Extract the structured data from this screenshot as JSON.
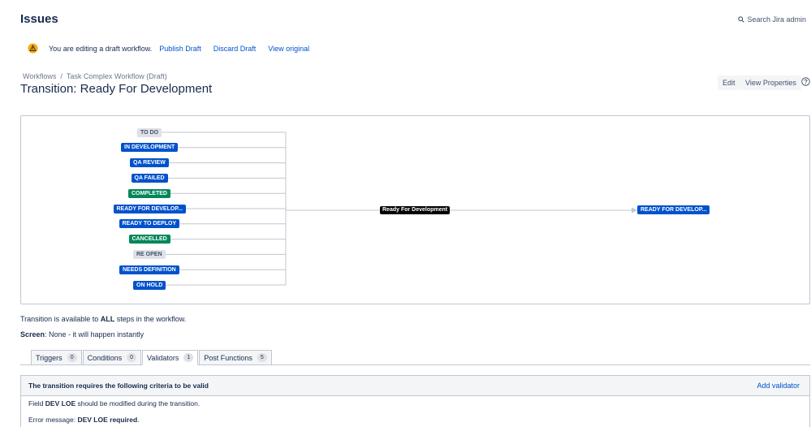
{
  "header": {
    "title": "Issues",
    "search_label": "Search Jira admin"
  },
  "draft_bar": {
    "message": "You are editing a draft workflow.",
    "publish": "Publish Draft",
    "discard": "Discard Draft",
    "view_original": "View original"
  },
  "breadcrumb": {
    "root": "Workflows",
    "sep": "/",
    "workflow": "Task Complex Workflow (Draft)"
  },
  "page": {
    "heading": "Transition: Ready For Development",
    "edit": "Edit",
    "view_properties": "View Properties"
  },
  "diagram": {
    "sources": [
      {
        "label": "TO DO",
        "color": "gray"
      },
      {
        "label": "IN DEVELOPMENT",
        "color": "blue"
      },
      {
        "label": "QA REVIEW",
        "color": "blue"
      },
      {
        "label": "QA FAILED",
        "color": "blue"
      },
      {
        "label": "COMPLETED",
        "color": "green"
      },
      {
        "label": "READY FOR DEVELOP...",
        "color": "blue"
      },
      {
        "label": "READY TO DEPLOY",
        "color": "blue"
      },
      {
        "label": "CANCELLED",
        "color": "green"
      },
      {
        "label": "RE OPEN",
        "color": "gray"
      },
      {
        "label": "NEEDS DEFINITION",
        "color": "blue"
      },
      {
        "label": "ON HOLD",
        "color": "blue"
      }
    ],
    "transition": "Ready For Development",
    "target": "READY FOR DEVELOP..."
  },
  "info": {
    "available_prefix": "Transition is available to ",
    "available_bold": "ALL",
    "available_suffix": " steps in the workflow.",
    "screen_label": "Screen",
    "screen_value": ": None - it will happen instantly"
  },
  "tabs": [
    {
      "label": "Triggers",
      "count": "0"
    },
    {
      "label": "Conditions",
      "count": "0"
    },
    {
      "label": "Validators",
      "count": "1"
    },
    {
      "label": "Post Functions",
      "count": "5"
    }
  ],
  "validators": {
    "header": "The transition requires the following criteria to be valid",
    "add": "Add validator",
    "row1_prefix": "Field ",
    "row1_bold": "DEV LOE",
    "row1_suffix": " should be modified during the transition.",
    "row2_prefix": "Error message: ",
    "row2_bold": "DEV LOE required",
    "row2_suffix": "."
  },
  "colors": {
    "link": "#0052cc",
    "blue": "#0052cc",
    "green": "#00875a",
    "gray": "#dfe1e6",
    "warning": "#ffab00"
  }
}
